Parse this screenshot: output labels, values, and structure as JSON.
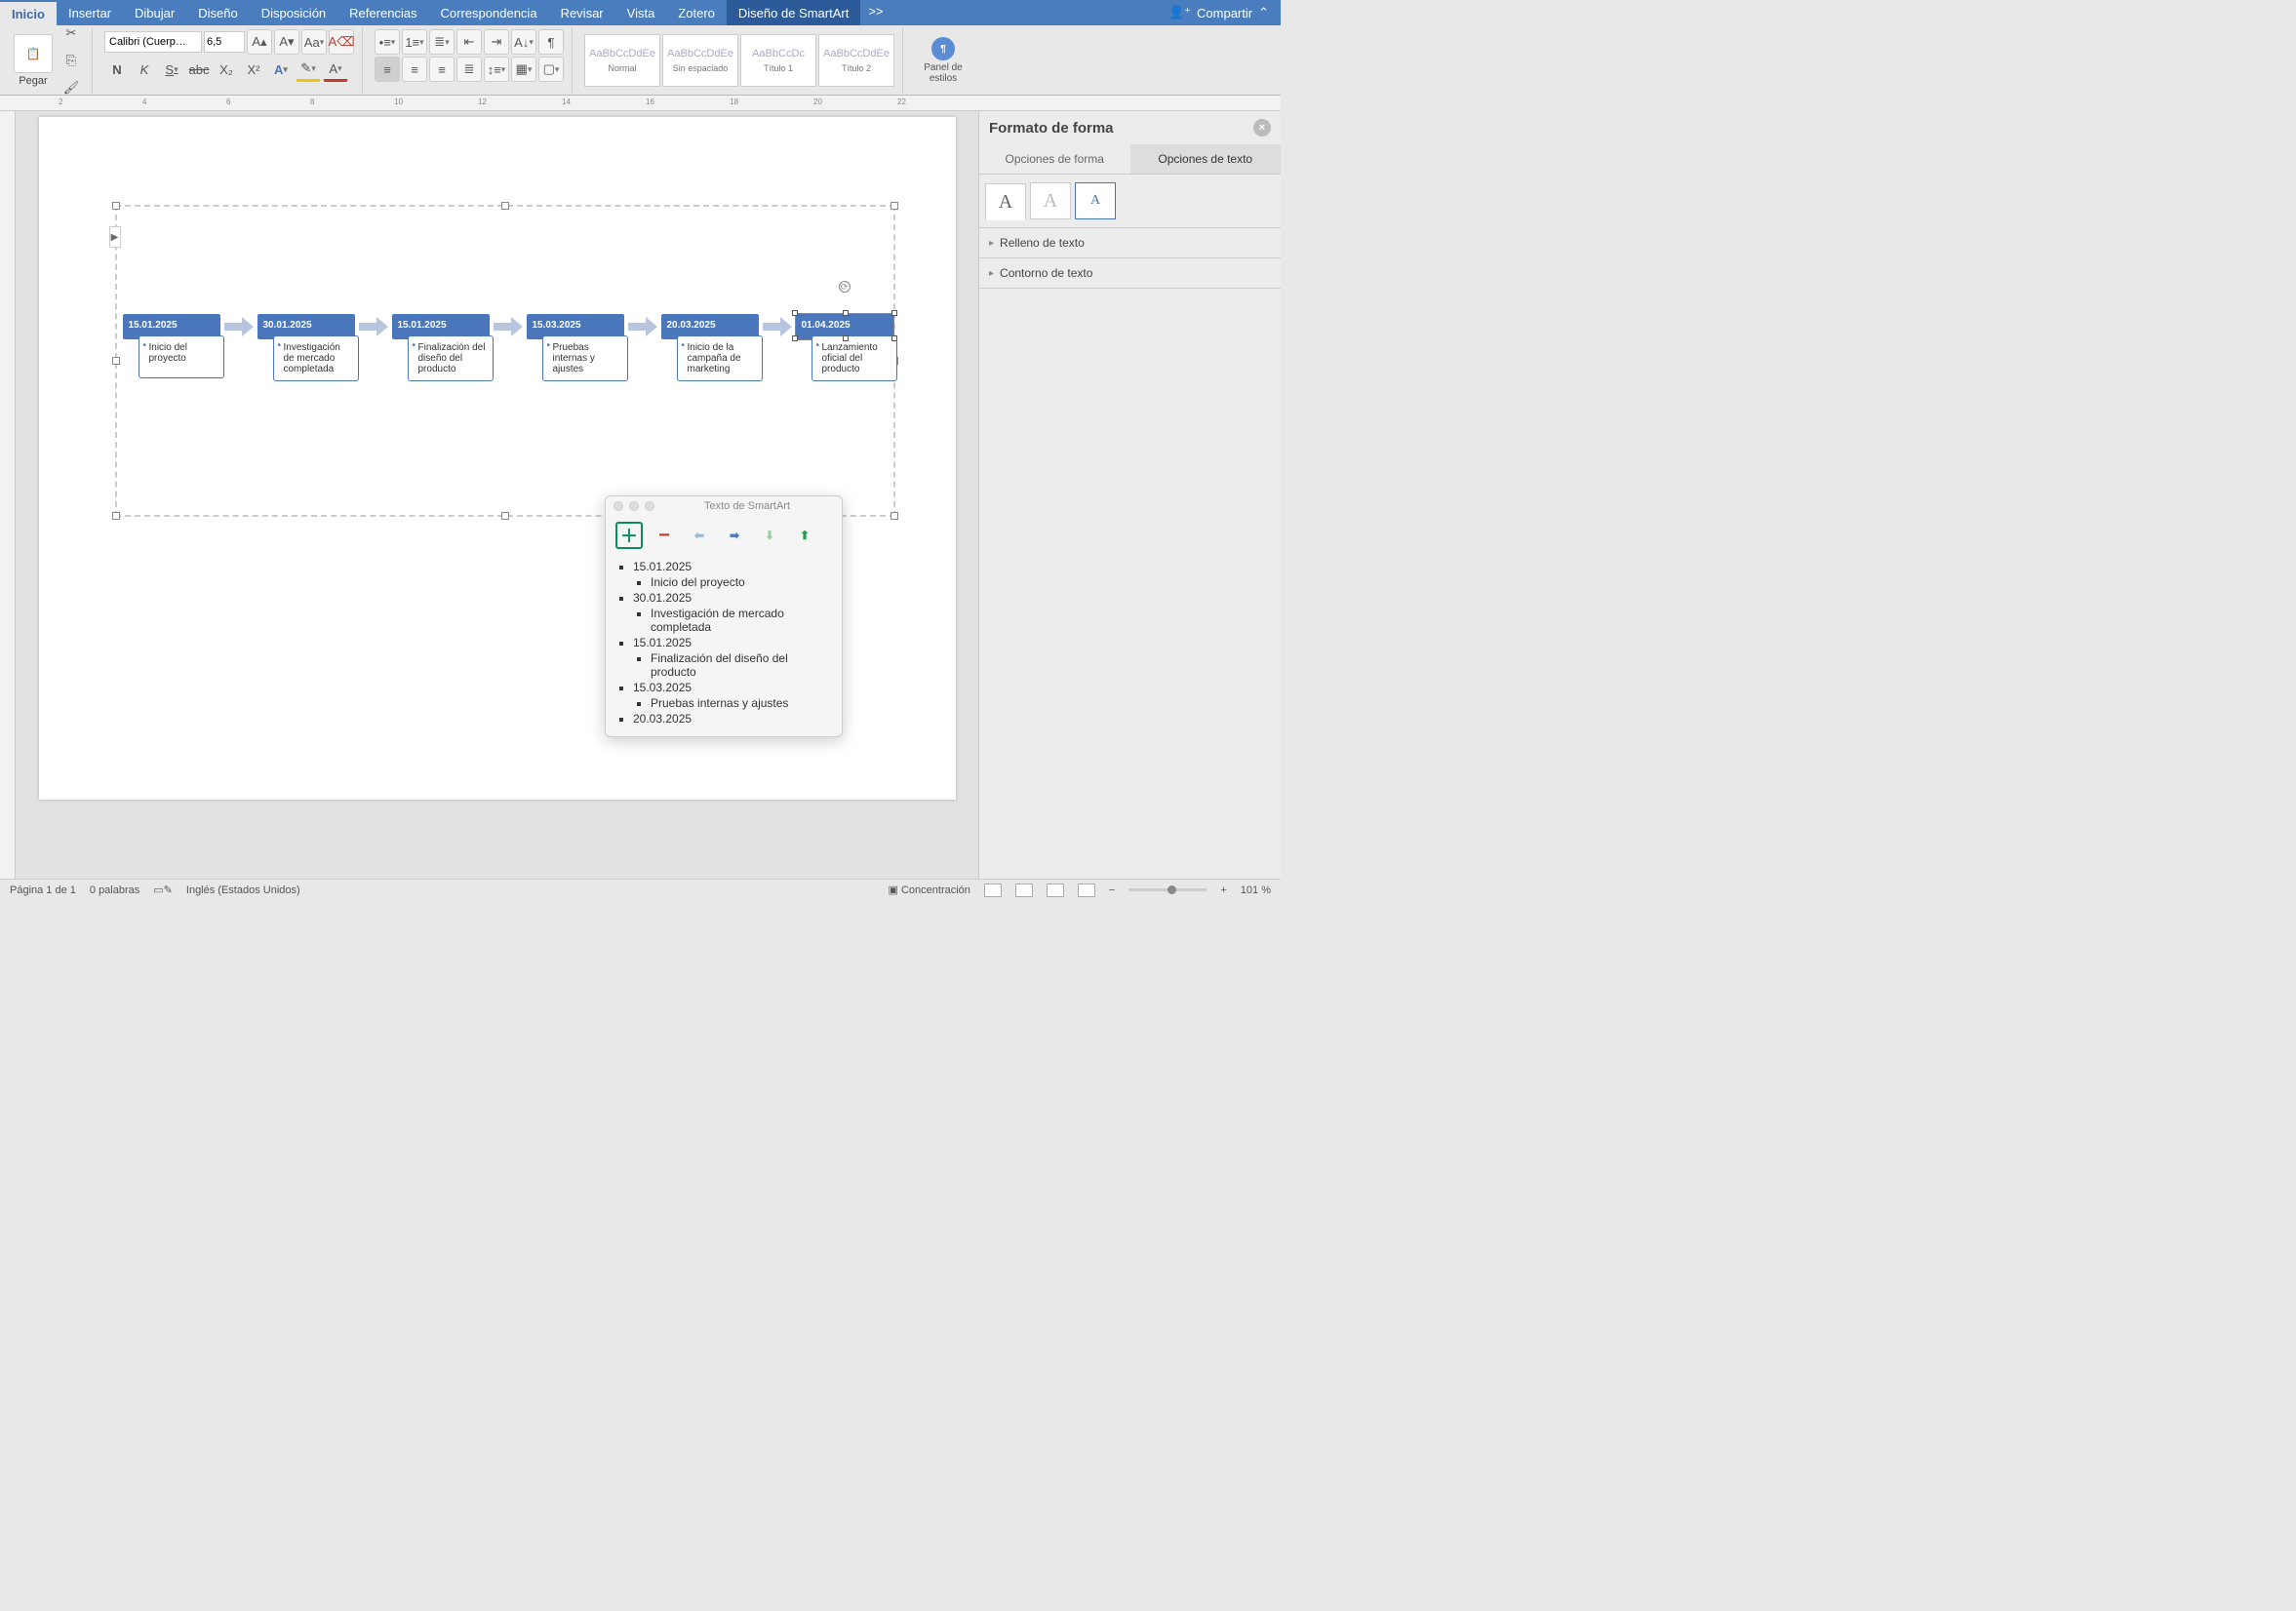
{
  "tabs": {
    "inicio": "Inicio",
    "insertar": "Insertar",
    "dibujar": "Dibujar",
    "diseno": "Diseño",
    "disposicion": "Disposición",
    "referencias": "Referencias",
    "correspondencia": "Correspondencia",
    "revisar": "Revisar",
    "vista": "Vista",
    "zotero": "Zotero",
    "smartart_design": "Diseño de SmartArt",
    "more": ">>",
    "share": "Compartir"
  },
  "ribbon": {
    "paste": "Pegar",
    "font_name": "Calibri (Cuerp…",
    "font_size": "6,5",
    "bold": "N",
    "italic": "K",
    "underline": "S",
    "strike": "abc",
    "subscript": "X₂",
    "superscript": "X²",
    "styles": [
      {
        "preview": "AaBbCcDdEe",
        "name": "Normal"
      },
      {
        "preview": "AaBbCcDdEe",
        "name": "Sin espaciado"
      },
      {
        "preview": "AaBbCcDc",
        "name": "Título 1"
      },
      {
        "preview": "AaBbCcDdEe",
        "name": "Título 2"
      }
    ],
    "styles_pane": "Panel de estilos"
  },
  "ruler_ticks": [
    "2",
    "4",
    "6",
    "8",
    "10",
    "12",
    "14",
    "16",
    "18",
    "20",
    "22"
  ],
  "smartart": {
    "items": [
      {
        "date": "15.01.2025",
        "desc": "Inicio del proyecto"
      },
      {
        "date": "30.01.2025",
        "desc": "Investigación de mercado completada"
      },
      {
        "date": "15.01.2025",
        "desc": "Finalización del diseño del producto"
      },
      {
        "date": "15.03.2025",
        "desc": "Pruebas internas y ajustes"
      },
      {
        "date": "20.03.2025",
        "desc": "Inicio de la campaña de marketing"
      },
      {
        "date": "01.04.2025",
        "desc": "Lanzamiento oficial del producto"
      }
    ]
  },
  "sa_textpanel": {
    "title": "Texto de SmartArt",
    "list": [
      {
        "l": 1,
        "t": "15.01.2025"
      },
      {
        "l": 2,
        "t": "Inicio del proyecto"
      },
      {
        "l": 1,
        "t": "30.01.2025"
      },
      {
        "l": 2,
        "t": "Investigación de mercado completada"
      },
      {
        "l": 1,
        "t": "15.01.2025"
      },
      {
        "l": 2,
        "t": "Finalización del diseño del producto"
      },
      {
        "l": 1,
        "t": "15.03.2025"
      },
      {
        "l": 2,
        "t": "Pruebas internas y ajustes"
      },
      {
        "l": 1,
        "t": "20.03.2025"
      }
    ]
  },
  "format_pane": {
    "title": "Formato de forma",
    "tab_shape": "Opciones de forma",
    "tab_text": "Opciones de texto",
    "sec_fill": "Relleno de texto",
    "sec_outline": "Contorno de texto"
  },
  "status": {
    "page": "Página 1 de 1",
    "words": "0 palabras",
    "lang": "Inglés (Estados Unidos)",
    "focus": "Concentración",
    "zoom": "101 %"
  }
}
